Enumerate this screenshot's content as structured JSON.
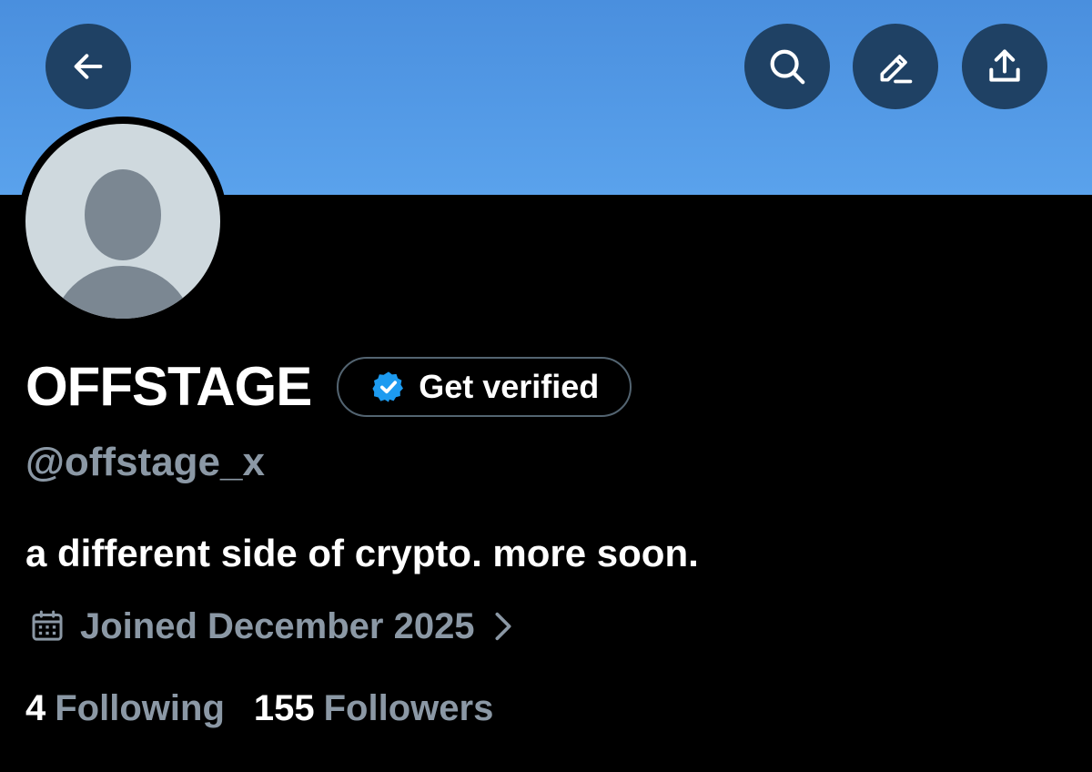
{
  "header": {
    "banner_color": "#4a8fde",
    "buttons": {
      "back": "arrow-left-icon",
      "search": "search-icon",
      "edit": "pencil-icon",
      "share": "share-upload-icon"
    }
  },
  "profile": {
    "display_name": "OFFSTAGE",
    "verify_label": "Get verified",
    "handle": "@offstage_x",
    "bio": "a different side of crypto. more soon.",
    "joined": "Joined December 2025",
    "following_count": "4",
    "following_label": "Following",
    "followers_count": "155",
    "followers_label": "Followers",
    "accent_color": "#1d9bf0"
  }
}
